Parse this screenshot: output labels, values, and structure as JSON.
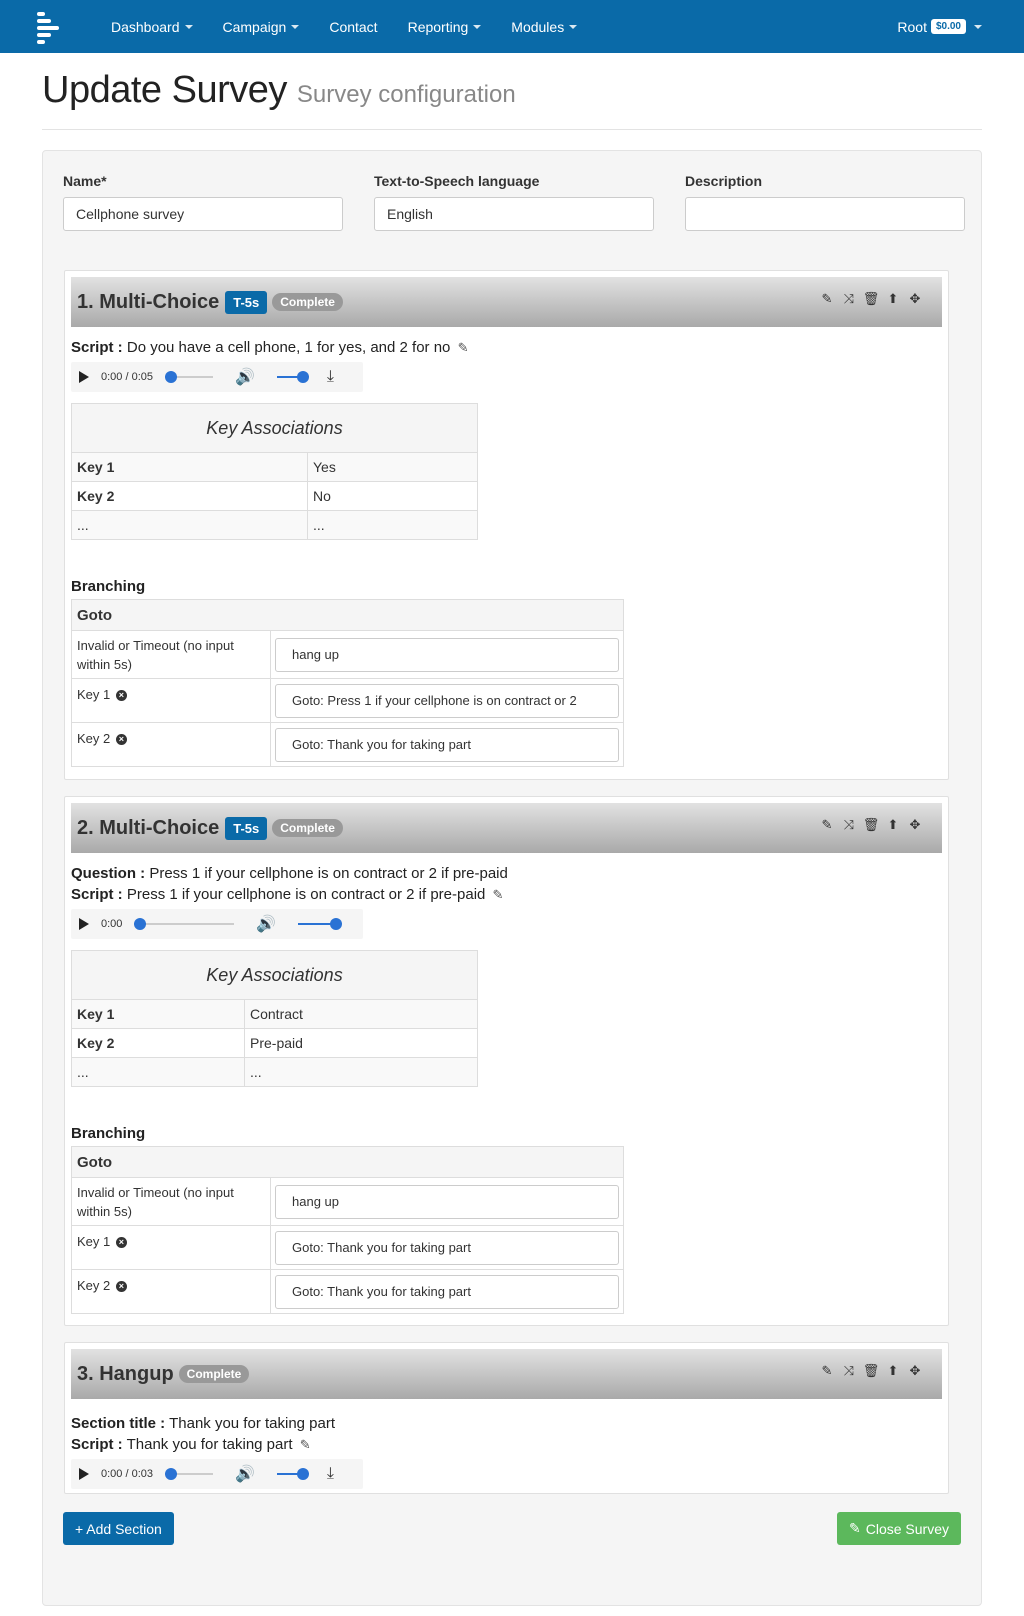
{
  "nav": {
    "items": [
      {
        "label": "Dashboard",
        "dropdown": true
      },
      {
        "label": "Campaign",
        "dropdown": true
      },
      {
        "label": "Contact",
        "dropdown": false
      },
      {
        "label": "Reporting",
        "dropdown": true
      },
      {
        "label": "Modules",
        "dropdown": true
      }
    ],
    "user": "Root",
    "balance": "$0.00"
  },
  "header": {
    "title": "Update Survey",
    "subtitle": "Survey configuration"
  },
  "form": {
    "name_label": "Name*",
    "name_value": "Cellphone survey",
    "tts_label": "Text-to-Speech language",
    "tts_value": "English",
    "desc_label": "Description",
    "desc_value": ""
  },
  "sections": [
    {
      "title": "1. Multi-Choice",
      "timeout_badge": "T-5s",
      "status": "Complete",
      "script_label": "Script :",
      "script_text": "Do you have a cell phone, 1 for yes, and 2 for no",
      "audio_time": "0:00 / 0:05",
      "keys_title": "Key Associations",
      "keys": [
        {
          "key": "Key 1",
          "value": "Yes"
        },
        {
          "key": "Key 2",
          "value": "No"
        },
        {
          "key": "...",
          "value": "..."
        }
      ],
      "branching_title": "Branching",
      "goto_header": "Goto",
      "branches": [
        {
          "key": "Invalid or Timeout (no input within 5s)",
          "goto": "hang up"
        },
        {
          "key": "Key  1",
          "goto": "Goto: Press 1 if your cellphone is on contract or 2"
        },
        {
          "key": "Key  2",
          "goto": "Goto: Thank you for taking part"
        }
      ]
    },
    {
      "title": "2. Multi-Choice",
      "timeout_badge": "T-5s",
      "status": "Complete",
      "question_label": "Question :",
      "question_text": "Press 1 if your cellphone is on contract or 2 if pre-paid",
      "script_label": "Script :",
      "script_text": "Press 1 if your cellphone is on contract or 2 if pre-paid",
      "audio_time": "0:00",
      "keys_title": "Key Associations",
      "keys": [
        {
          "key": "Key 1",
          "value": "Contract"
        },
        {
          "key": "Key 2",
          "value": "Pre-paid"
        },
        {
          "key": "...",
          "value": "..."
        }
      ],
      "branching_title": "Branching",
      "goto_header": "Goto",
      "branches": [
        {
          "key": "Invalid or Timeout (no input within 5s)",
          "goto": "hang up"
        },
        {
          "key": "Key  1",
          "goto": "Goto: Thank you for taking part"
        },
        {
          "key": "Key  2",
          "goto": "Goto: Thank you for taking part"
        }
      ]
    },
    {
      "title": "3. Hangup",
      "status": "Complete",
      "section_title_label": "Section title :",
      "section_title_text": "Thank you for taking part",
      "script_label": "Script :",
      "script_text": "Thank you for taking part",
      "audio_time": "0:00 / 0:03"
    }
  ],
  "actions": {
    "add_section": "+ Add Section",
    "close_survey": "Close Survey"
  },
  "icons": {
    "brand": "stacked-bars-logo",
    "section_tools": [
      "pencil-icon",
      "shuffle-icon",
      "trash-icon",
      "up-arrow-icon",
      "move-icon"
    ]
  },
  "colors": {
    "navbar": "#0a6aa8",
    "primary": "#0a6aa8",
    "success": "#5cb85c",
    "complete_badge": "#999999"
  }
}
